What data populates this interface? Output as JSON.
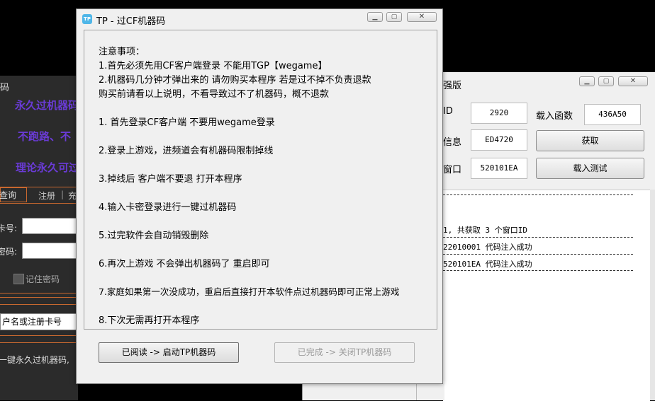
{
  "left_window": {
    "title_fragment": "码",
    "promo_lines": [
      "永久过机器码",
      "不跑路、不",
      "理论永久可过"
    ],
    "tabs": {
      "query": "查询",
      "register": "注册",
      "separator": "|",
      "charge": "充"
    },
    "card_label": "卡号:",
    "password_label": "密码:",
    "remember_label": "记住密码",
    "account_placeholder": "户名或注册卡号",
    "footer_text": "一键永久过机器码,"
  },
  "right_window": {
    "title_fragment": "强版",
    "label_id": "ID",
    "value_id": "2920",
    "label_load_func": "载入函数",
    "value_load_func": "436A50",
    "label_info": "信息",
    "value_info": "ED4720",
    "btn_fetch": "获取",
    "label_window": "窗口",
    "value_window": "520101EA",
    "btn_load_test": "载入测试",
    "log_lines": [
      "1, 共获取 3 个窗口ID",
      "22010001 代码注入成功",
      "520101EA 代码注入成功"
    ]
  },
  "dialog": {
    "icon_text": "TP",
    "title": "TP - 过CF机器码",
    "notes": [
      "注意事项：",
      "1.首先必须先用CF客户端登录 不能用TGP【wegame】",
      "2.机器码几分钟才弹出来的 请勿购买本程序 若是过不掉不负责退款",
      "购买前请看以上说明，不看导致过不了机器码，概不退款",
      "1. 首先登录CF客户端 不要用wegame登录",
      "2.登录上游戏，进频道会有机器码限制掉线",
      "3.掉线后 客户端不要退 打开本程序",
      "4.输入卡密登录进行一键过机器码",
      "5.过完软件会自动销毁删除",
      "6.再次上游戏 不会弹出机器码了 重启即可",
      "7.家庭如果第一次没成功，重启后直接打开本软件点过机器码即可正常上游戏",
      "8.下次无需再打开本程序"
    ],
    "btn_start": "已阅读 -> 启动TP机器码",
    "btn_close": "已完成 -> 关闭TP机器码"
  }
}
